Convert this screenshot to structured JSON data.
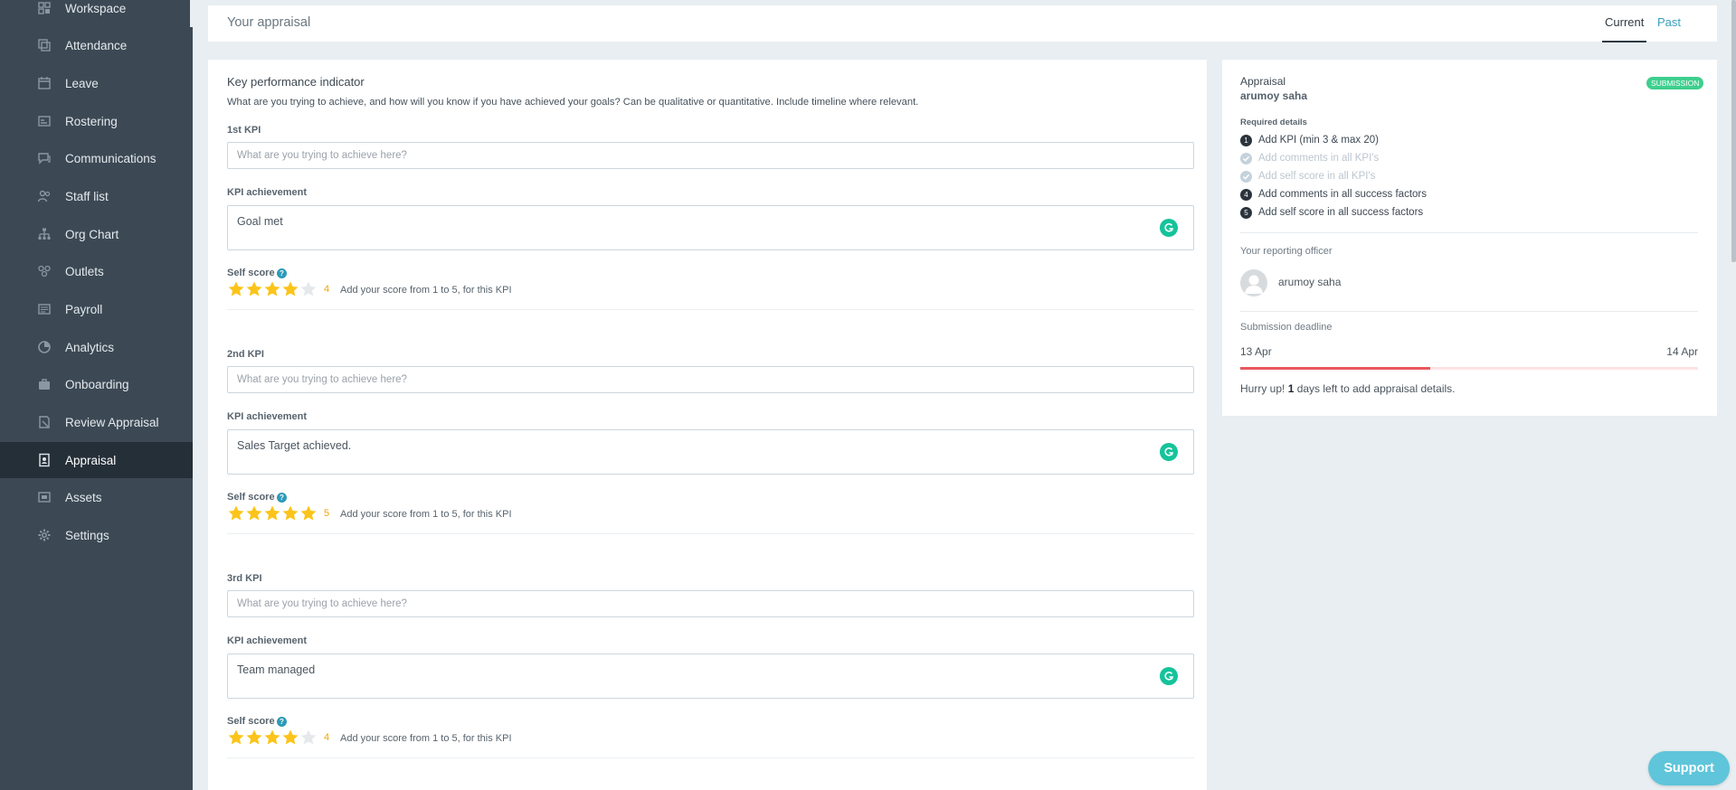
{
  "sidebar": {
    "items": [
      {
        "label": "Workspace",
        "icon": "workspace-icon",
        "active": false
      },
      {
        "label": "Attendance",
        "icon": "attendance-icon",
        "active": false
      },
      {
        "label": "Leave",
        "icon": "leave-icon",
        "active": false
      },
      {
        "label": "Rostering",
        "icon": "rostering-icon",
        "active": false
      },
      {
        "label": "Communications",
        "icon": "communications-icon",
        "active": false
      },
      {
        "label": "Staff list",
        "icon": "staff-list-icon",
        "active": false
      },
      {
        "label": "Org Chart",
        "icon": "org-chart-icon",
        "active": false
      },
      {
        "label": "Outlets",
        "icon": "outlets-icon",
        "active": false
      },
      {
        "label": "Payroll",
        "icon": "payroll-icon",
        "active": false
      },
      {
        "label": "Analytics",
        "icon": "analytics-icon",
        "active": false
      },
      {
        "label": "Onboarding",
        "icon": "onboarding-icon",
        "active": false
      },
      {
        "label": "Review Appraisal",
        "icon": "review-appraisal-icon",
        "active": false
      },
      {
        "label": "Appraisal",
        "icon": "appraisal-icon",
        "active": true
      },
      {
        "label": "Assets",
        "icon": "assets-icon",
        "active": false
      },
      {
        "label": "Settings",
        "icon": "gear-icon",
        "active": false
      }
    ]
  },
  "header": {
    "title": "Your appraisal",
    "tab_current": "Current",
    "tab_past": "Past"
  },
  "kpi": {
    "title": "Key performance indicator",
    "description": "What are you trying to achieve, and how will you know if you have achieved your goals? Can be qualitative or quantitative. Include timeline where relevant.",
    "input_placeholder": "What are you trying to achieve here?",
    "achievement_label": "KPI achievement",
    "self_score_label": "Self score",
    "score_hint": "Add your score from 1 to 5, for this KPI",
    "max_stars": 5,
    "items": [
      {
        "label": "1st KPI",
        "value": "",
        "achievement": "Goal met",
        "score": 4,
        "score_text": "4"
      },
      {
        "label": "2nd KPI",
        "value": "",
        "achievement": "Sales Target achieved.",
        "score": 5,
        "score_text": "5"
      },
      {
        "label": "3rd KPI",
        "value": "",
        "achievement": "Team managed",
        "score": 4,
        "score_text": "4"
      }
    ]
  },
  "summary": {
    "title": "Appraisal",
    "employee": "arumoy saha",
    "status_badge": "SUBMISSION",
    "required_label": "Required details",
    "requirements": [
      {
        "num": "1",
        "text": "Add KPI (min 3 & max 20)",
        "done": false
      },
      {
        "num": "",
        "text": "Add comments in all KPI's",
        "done": true
      },
      {
        "num": "",
        "text": "Add self score in all KPI's",
        "done": true
      },
      {
        "num": "4",
        "text": "Add comments in all success factors",
        "done": false
      },
      {
        "num": "5",
        "text": "Add self score in all success factors",
        "done": false
      }
    ],
    "officer_label": "Your reporting officer",
    "officer_name": "arumoy saha",
    "deadline_label": "Submission deadline",
    "deadline_start": "13 Apr",
    "deadline_end": "14 Apr",
    "deadline_progress": 0.415,
    "hurry_prefix": "Hurry up! ",
    "hurry_days": "1",
    "hurry_suffix": " days left to add appraisal details."
  },
  "support": {
    "label": "Support"
  },
  "colors": {
    "sidebar_bg": "#3c4955",
    "sidebar_active": "#252f38",
    "accent": "#3aa0bd",
    "star_on": "#fcc419",
    "star_off": "#e6e9ec",
    "badge": "#3ecf8e",
    "deadline_bar": "#e8585d",
    "grammarly": "#15c39a"
  }
}
